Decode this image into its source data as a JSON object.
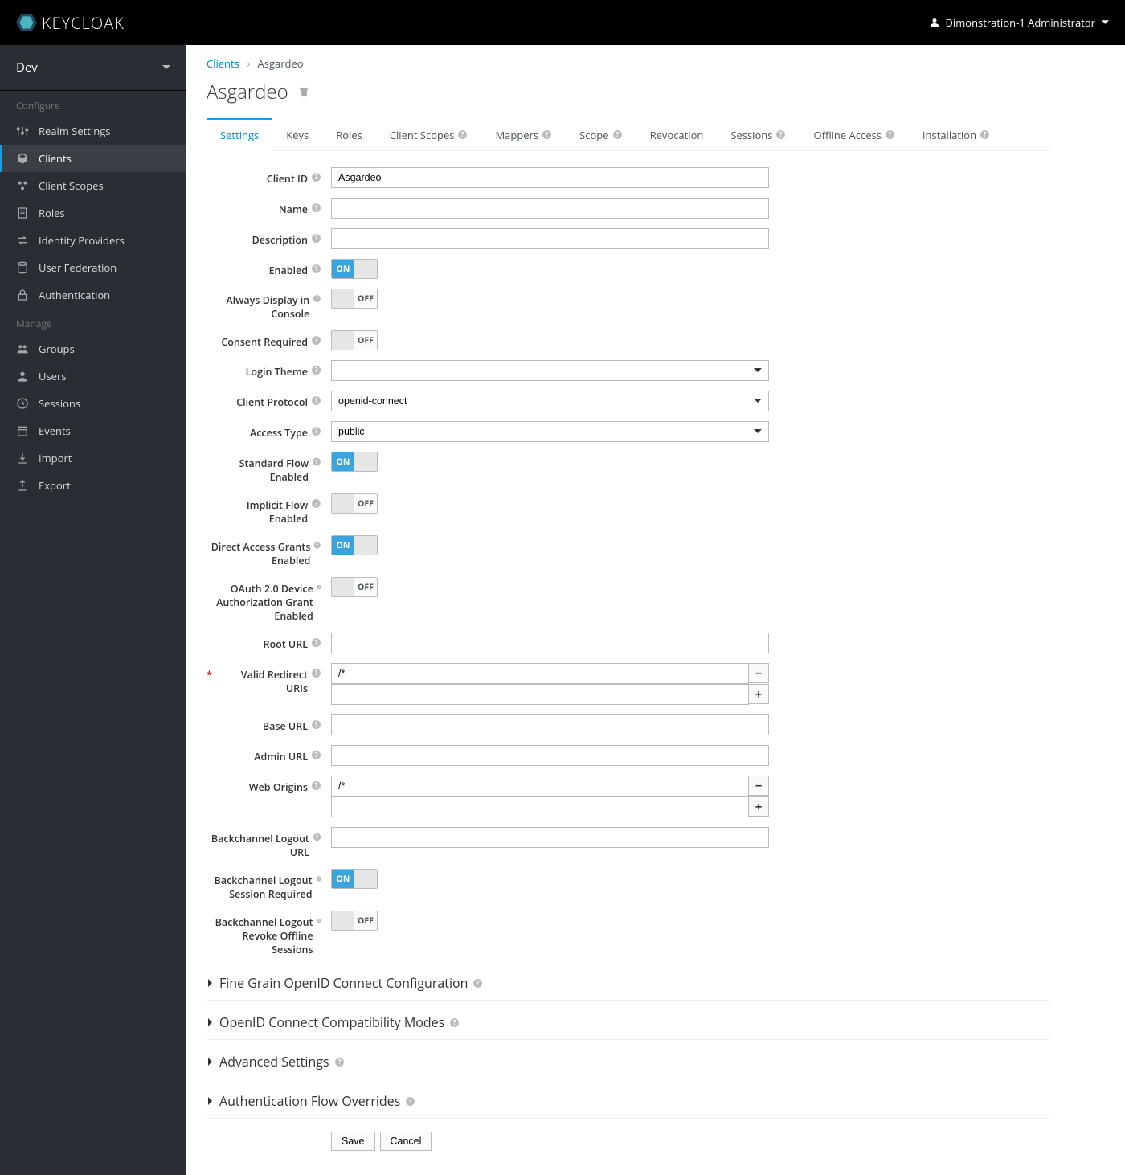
{
  "brand": "KEYCLOAK",
  "user": "Dimonstration-1 Administrator",
  "realm": "Dev",
  "sidebar": {
    "configure_label": "Configure",
    "manage_label": "Manage",
    "configure": [
      {
        "label": "Realm Settings"
      },
      {
        "label": "Clients",
        "active": true
      },
      {
        "label": "Client Scopes"
      },
      {
        "label": "Roles"
      },
      {
        "label": "Identity Providers"
      },
      {
        "label": "User Federation"
      },
      {
        "label": "Authentication"
      }
    ],
    "manage": [
      {
        "label": "Groups"
      },
      {
        "label": "Users"
      },
      {
        "label": "Sessions"
      },
      {
        "label": "Events"
      },
      {
        "label": "Import"
      },
      {
        "label": "Export"
      }
    ]
  },
  "breadcrumb": {
    "root": "Clients",
    "current": "Asgardeo"
  },
  "page_title": "Asgardeo",
  "tabs": [
    {
      "label": "Settings",
      "active": true
    },
    {
      "label": "Keys"
    },
    {
      "label": "Roles"
    },
    {
      "label": "Client Scopes",
      "help": true
    },
    {
      "label": "Mappers",
      "help": true
    },
    {
      "label": "Scope",
      "help": true
    },
    {
      "label": "Revocation"
    },
    {
      "label": "Sessions",
      "help": true
    },
    {
      "label": "Offline Access",
      "help": true
    },
    {
      "label": "Installation",
      "help": true
    }
  ],
  "fields": {
    "client_id": {
      "label": "Client ID",
      "value": "Asgardeo"
    },
    "name": {
      "label": "Name",
      "value": ""
    },
    "description": {
      "label": "Description",
      "value": ""
    },
    "enabled": {
      "label": "Enabled",
      "on": true
    },
    "always_display": {
      "label": "Always Display in Console",
      "on": false
    },
    "consent_required": {
      "label": "Consent Required",
      "on": false
    },
    "login_theme": {
      "label": "Login Theme",
      "value": ""
    },
    "client_protocol": {
      "label": "Client Protocol",
      "value": "openid-connect"
    },
    "access_type": {
      "label": "Access Type",
      "value": "public"
    },
    "standard_flow": {
      "label": "Standard Flow Enabled",
      "on": true
    },
    "implicit_flow": {
      "label": "Implicit Flow Enabled",
      "on": false
    },
    "direct_access": {
      "label": "Direct Access Grants Enabled",
      "on": true
    },
    "oauth_device": {
      "label": "OAuth 2.0 Device Authorization Grant Enabled",
      "on": false
    },
    "root_url": {
      "label": "Root URL",
      "value": ""
    },
    "valid_redirect": {
      "label": "Valid Redirect URIs",
      "required": true,
      "values": [
        "/*"
      ]
    },
    "base_url": {
      "label": "Base URL",
      "value": ""
    },
    "admin_url": {
      "label": "Admin URL",
      "value": ""
    },
    "web_origins": {
      "label": "Web Origins",
      "values": [
        "/*"
      ]
    },
    "backchannel_logout_url": {
      "label": "Backchannel Logout URL",
      "value": ""
    },
    "backchannel_session_required": {
      "label": "Backchannel Logout Session Required",
      "on": true
    },
    "backchannel_revoke_offline": {
      "label": "Backchannel Logout Revoke Offline Sessions",
      "on": false
    }
  },
  "sections": [
    {
      "title": "Fine Grain OpenID Connect Configuration"
    },
    {
      "title": "OpenID Connect Compatibility Modes"
    },
    {
      "title": "Advanced Settings"
    },
    {
      "title": "Authentication Flow Overrides"
    }
  ],
  "buttons": {
    "save": "Save",
    "cancel": "Cancel"
  },
  "toggle_on": "ON",
  "toggle_off": "OFF"
}
